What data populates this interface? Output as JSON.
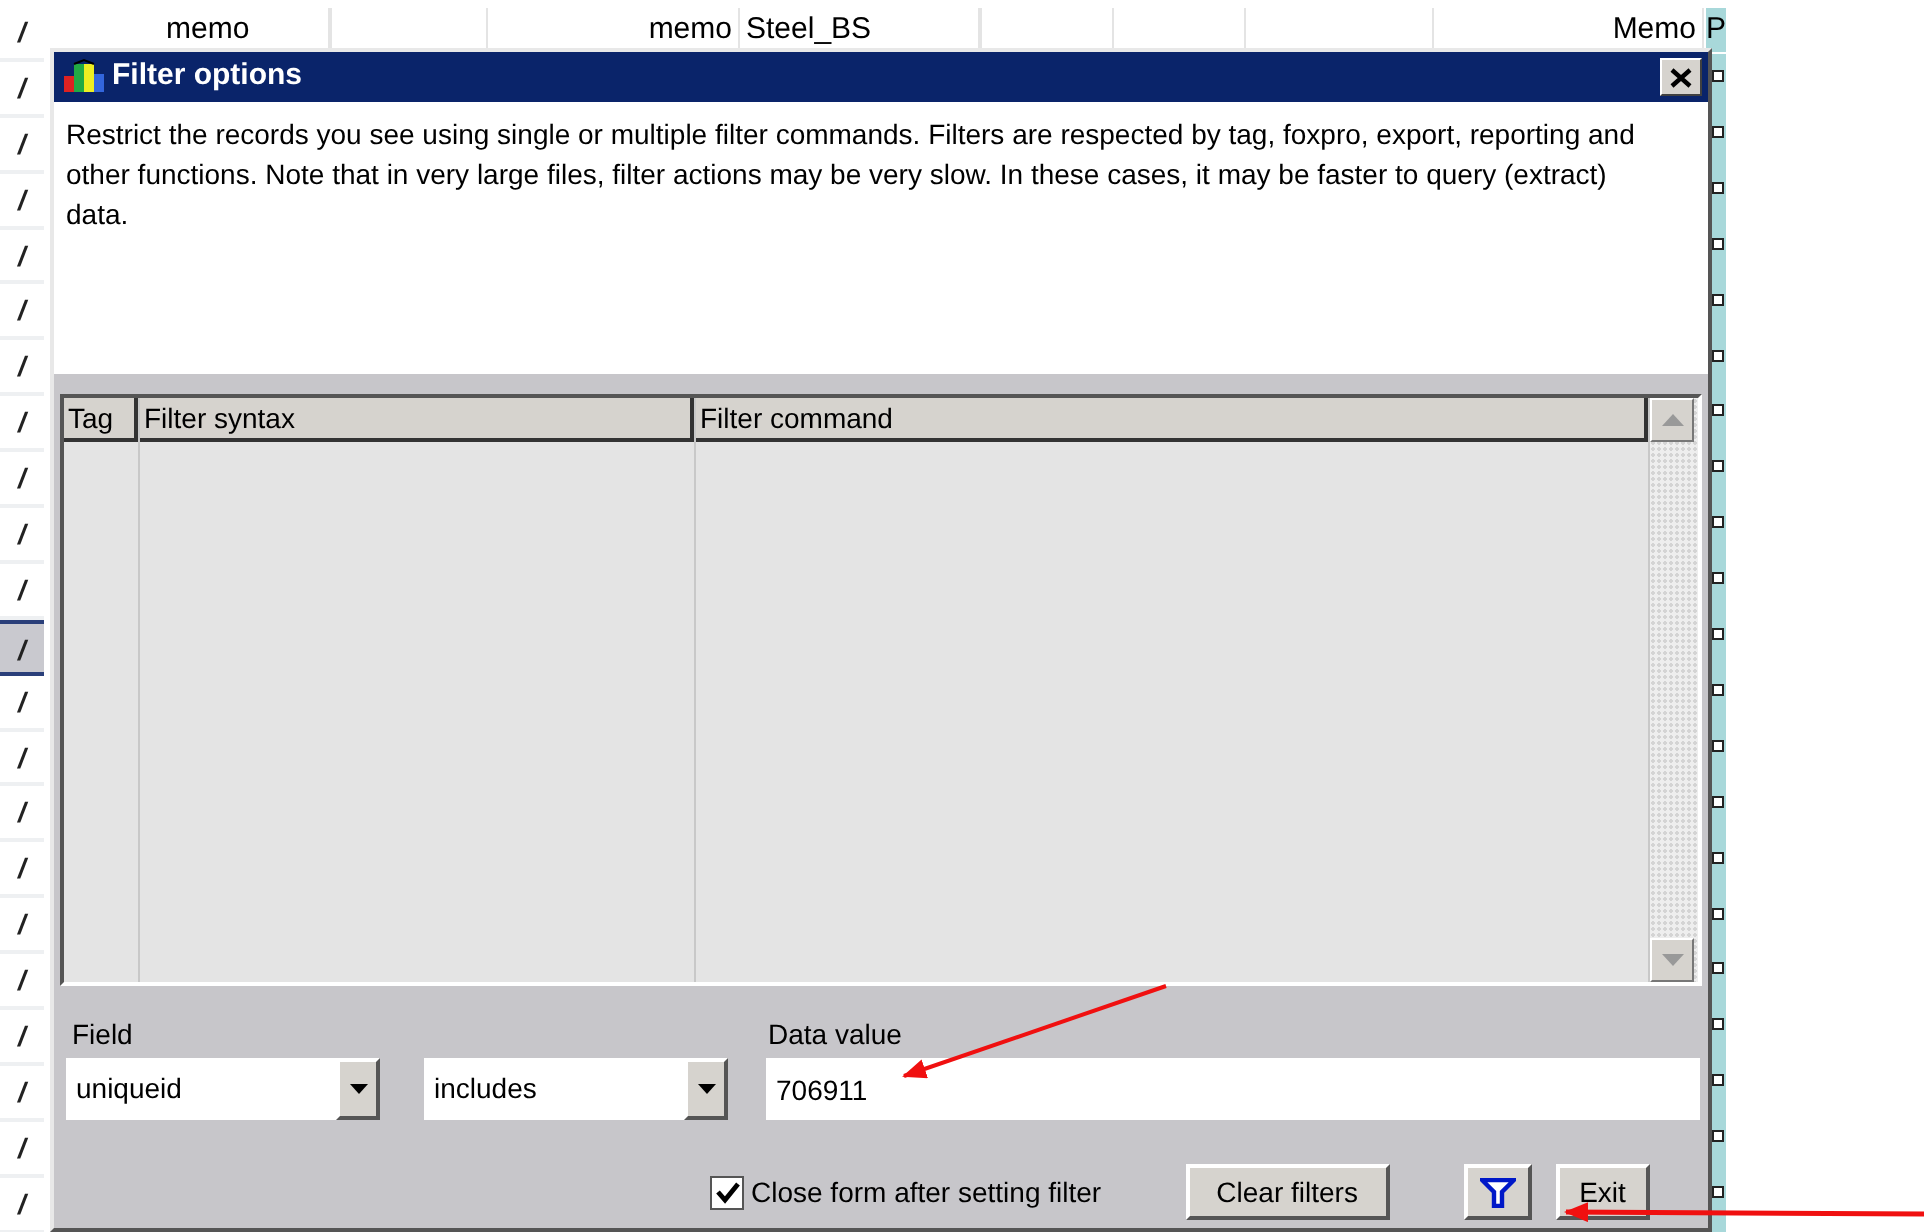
{
  "background_grid": {
    "header_cells": [
      {
        "text": "memo"
      },
      {
        "text": "memo"
      },
      {
        "text": "Steel_BS"
      },
      {
        "text": "Memo"
      },
      {
        "text": "P"
      }
    ],
    "rows": [
      {
        "mark": "/",
        "selected": false
      },
      {
        "mark": "/",
        "selected": false
      },
      {
        "mark": "/",
        "selected": false
      },
      {
        "mark": "/",
        "selected": false
      },
      {
        "mark": "/",
        "selected": false
      },
      {
        "mark": "/",
        "selected": false
      },
      {
        "mark": "/",
        "selected": false
      },
      {
        "mark": "/",
        "selected": false
      },
      {
        "mark": "/",
        "selected": false
      },
      {
        "mark": "/",
        "selected": false
      },
      {
        "mark": "/",
        "selected": false
      },
      {
        "mark": "/",
        "selected": true
      },
      {
        "mark": "/",
        "selected": false
      },
      {
        "mark": "/",
        "selected": false
      },
      {
        "mark": "/",
        "selected": false
      },
      {
        "mark": "/",
        "selected": false
      },
      {
        "mark": "/",
        "selected": false
      },
      {
        "mark": "/",
        "selected": false
      },
      {
        "mark": "/",
        "selected": false
      },
      {
        "mark": "/",
        "selected": false
      },
      {
        "mark": "/",
        "selected": false
      },
      {
        "mark": "/",
        "selected": false
      }
    ]
  },
  "dialog": {
    "title": "Filter options",
    "description": "Restrict the records you see using single or multiple filter commands. Filters are respected by tag, foxpro, export, reporting and other functions. Note that in very large files, filter actions may be very slow. In these cases, it may be faster to query (extract) data.",
    "table": {
      "columns": [
        "Tag",
        "Filter syntax",
        "Filter command"
      ]
    },
    "field_label": "Field",
    "field_combo": {
      "value": "uniqueid"
    },
    "operator_combo": {
      "value": "includes"
    },
    "data_value_label": "Data value",
    "data_value": "706911",
    "close_form": {
      "label": "Close form after setting filter",
      "checked": true
    },
    "buttons": [
      {
        "kind": "text",
        "label": "Clear filters"
      },
      {
        "kind": "filter"
      },
      {
        "kind": "text",
        "label": "Exit"
      }
    ]
  }
}
